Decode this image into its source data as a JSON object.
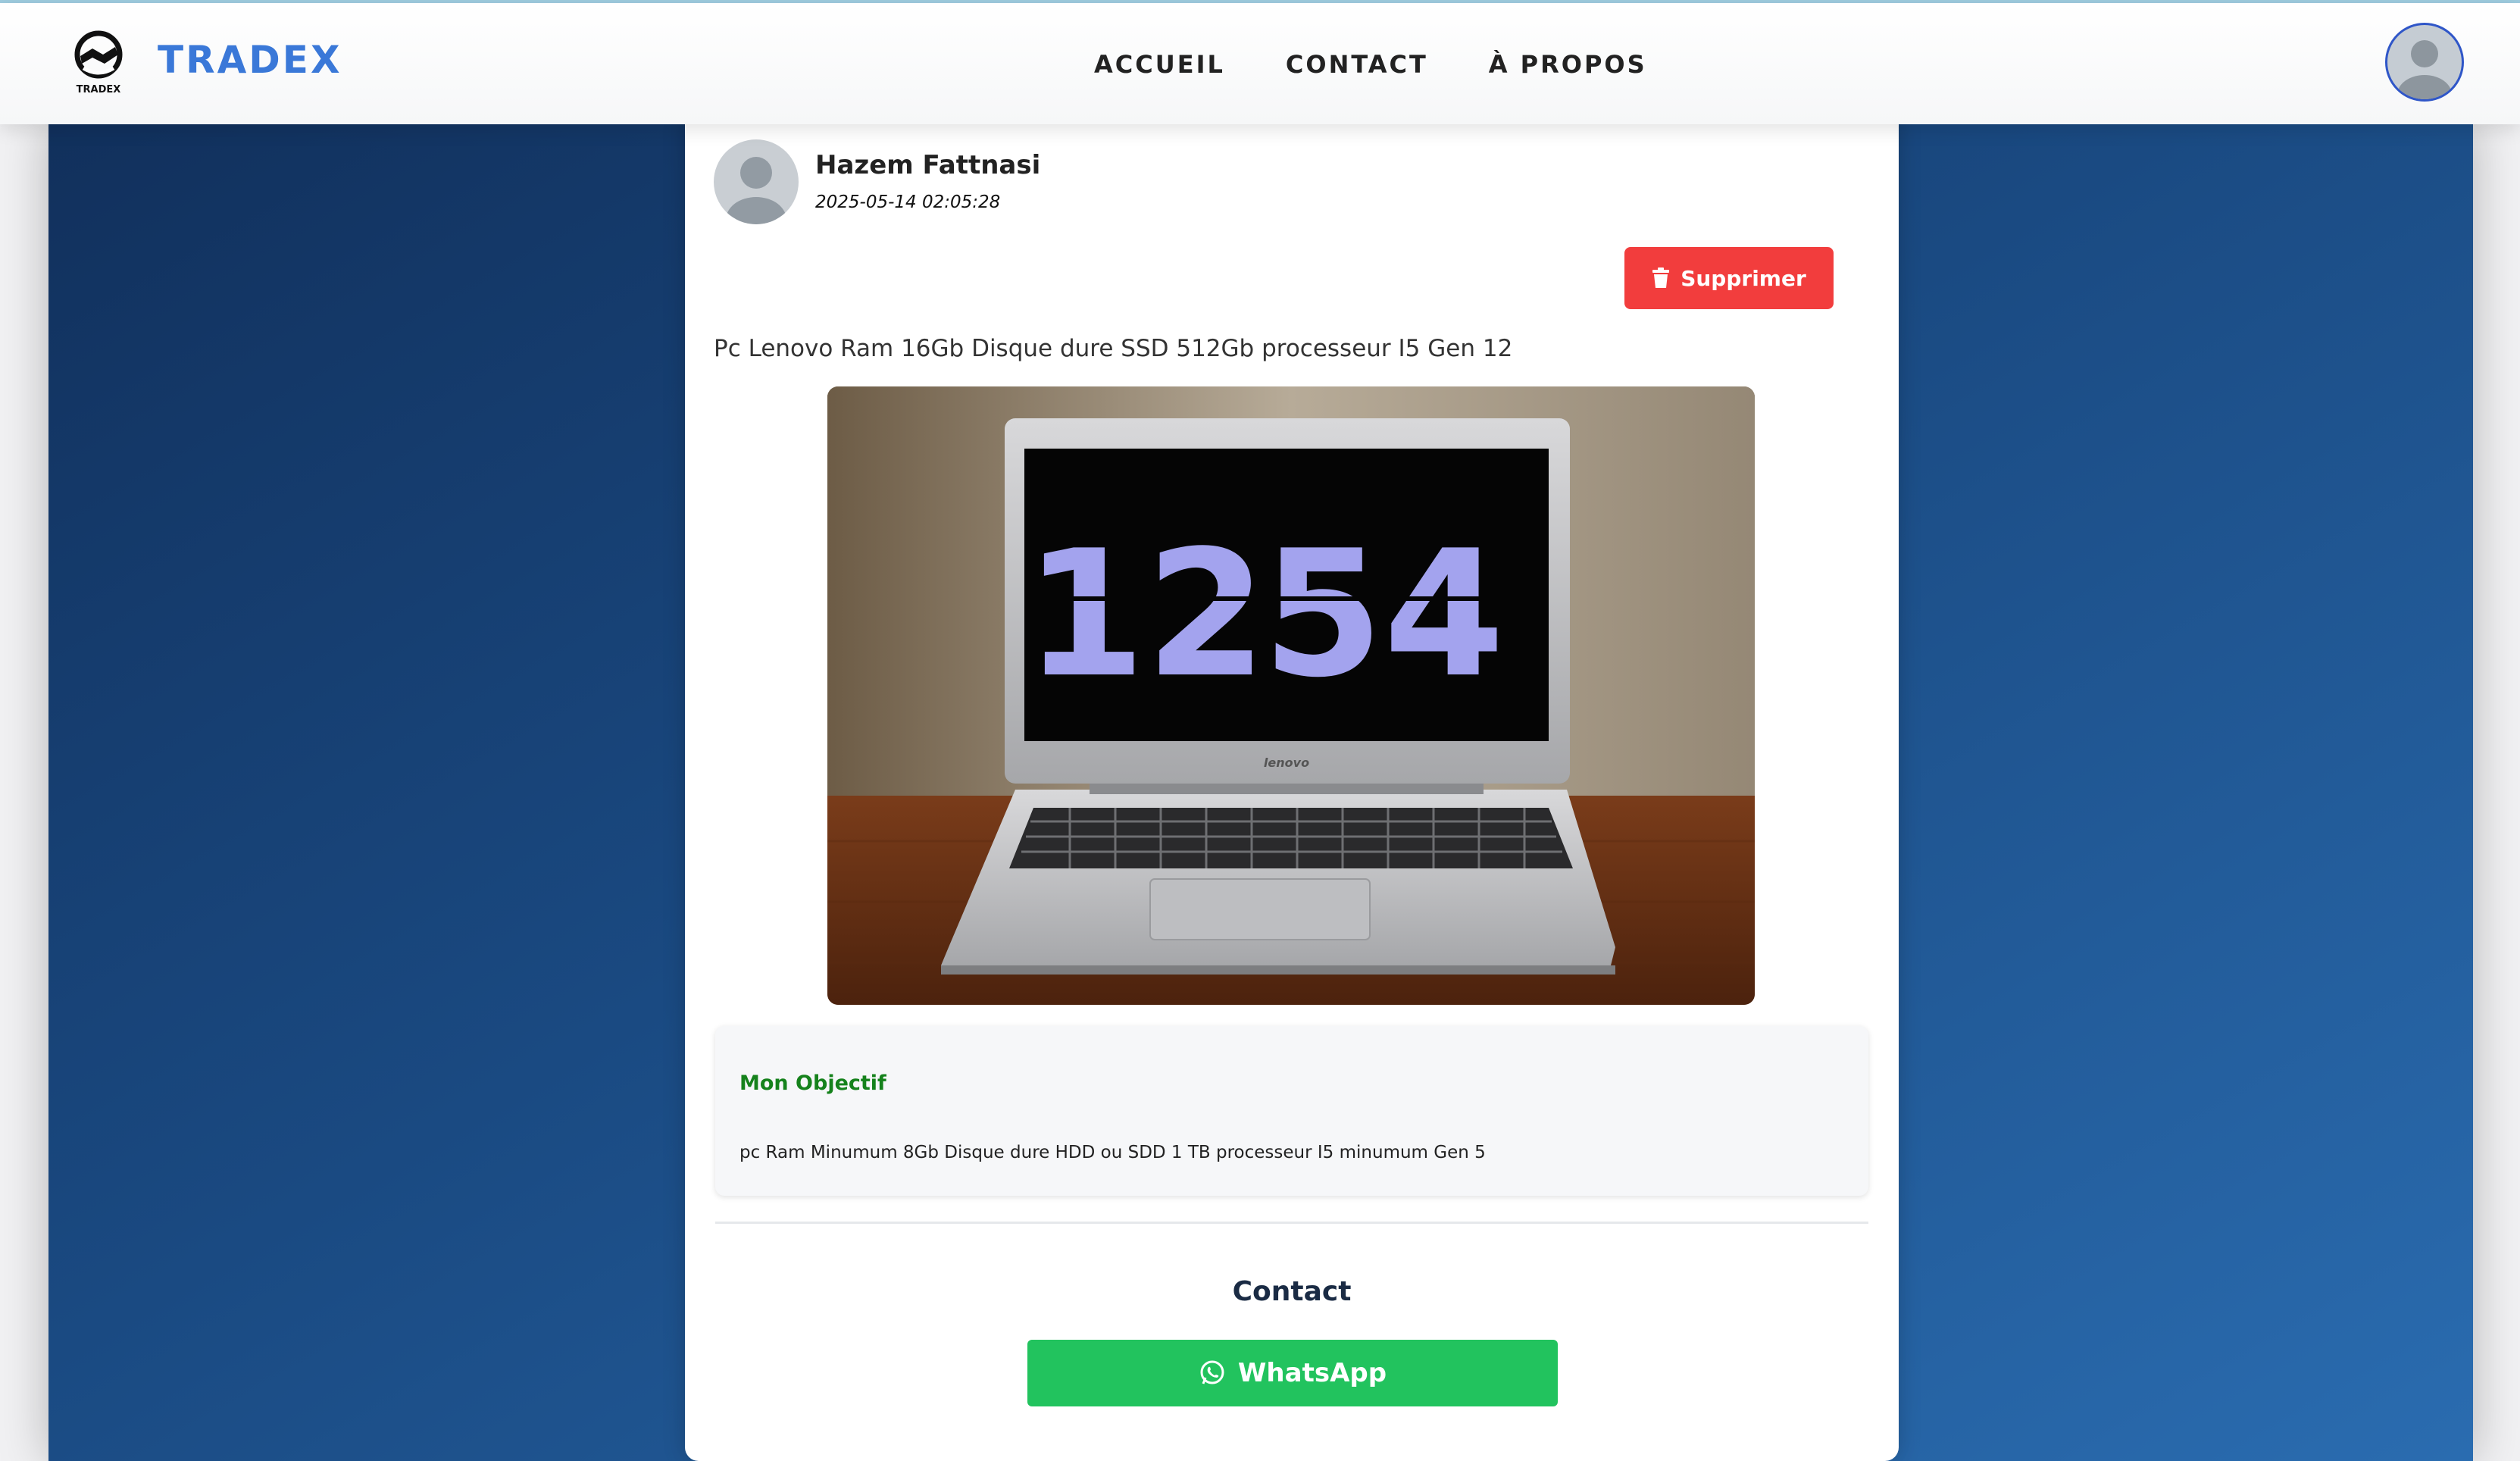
{
  "header": {
    "logo_text": "TRADEX",
    "brand": "TRADEX",
    "nav": [
      {
        "label": "ACCUEIL"
      },
      {
        "label": "CONTACT"
      },
      {
        "label": "À PROPOS"
      }
    ]
  },
  "post": {
    "author": "Hazem Fattnasi",
    "date": "2025-05-14 02:05:28",
    "delete_label": "Supprimer",
    "description": "Pc Lenovo Ram 16Gb Disque dure SSD 512Gb processeur I5 Gen 12",
    "image": {
      "screen_hours": "12",
      "screen_minutes": "54",
      "brand_label": "lenovo"
    },
    "objective": {
      "title": "Mon Objectif",
      "text": "pc Ram Minumum 8Gb Disque dure HDD ou SDD 1 TB processeur I5 minumum Gen 5"
    },
    "contact": {
      "title": "Contact",
      "whatsapp_label": "WhatsApp"
    }
  },
  "colors": {
    "brand_blue": "#3a78d8",
    "delete_red": "#f23d3d",
    "whatsapp_green": "#22c35e",
    "objective_title_green": "#15821c",
    "background_blue": "#1a4a82"
  },
  "icons": {
    "logo": "handshake-logo-icon",
    "avatar": "user-avatar-icon",
    "delete": "trash-icon",
    "whatsapp": "whatsapp-icon"
  }
}
